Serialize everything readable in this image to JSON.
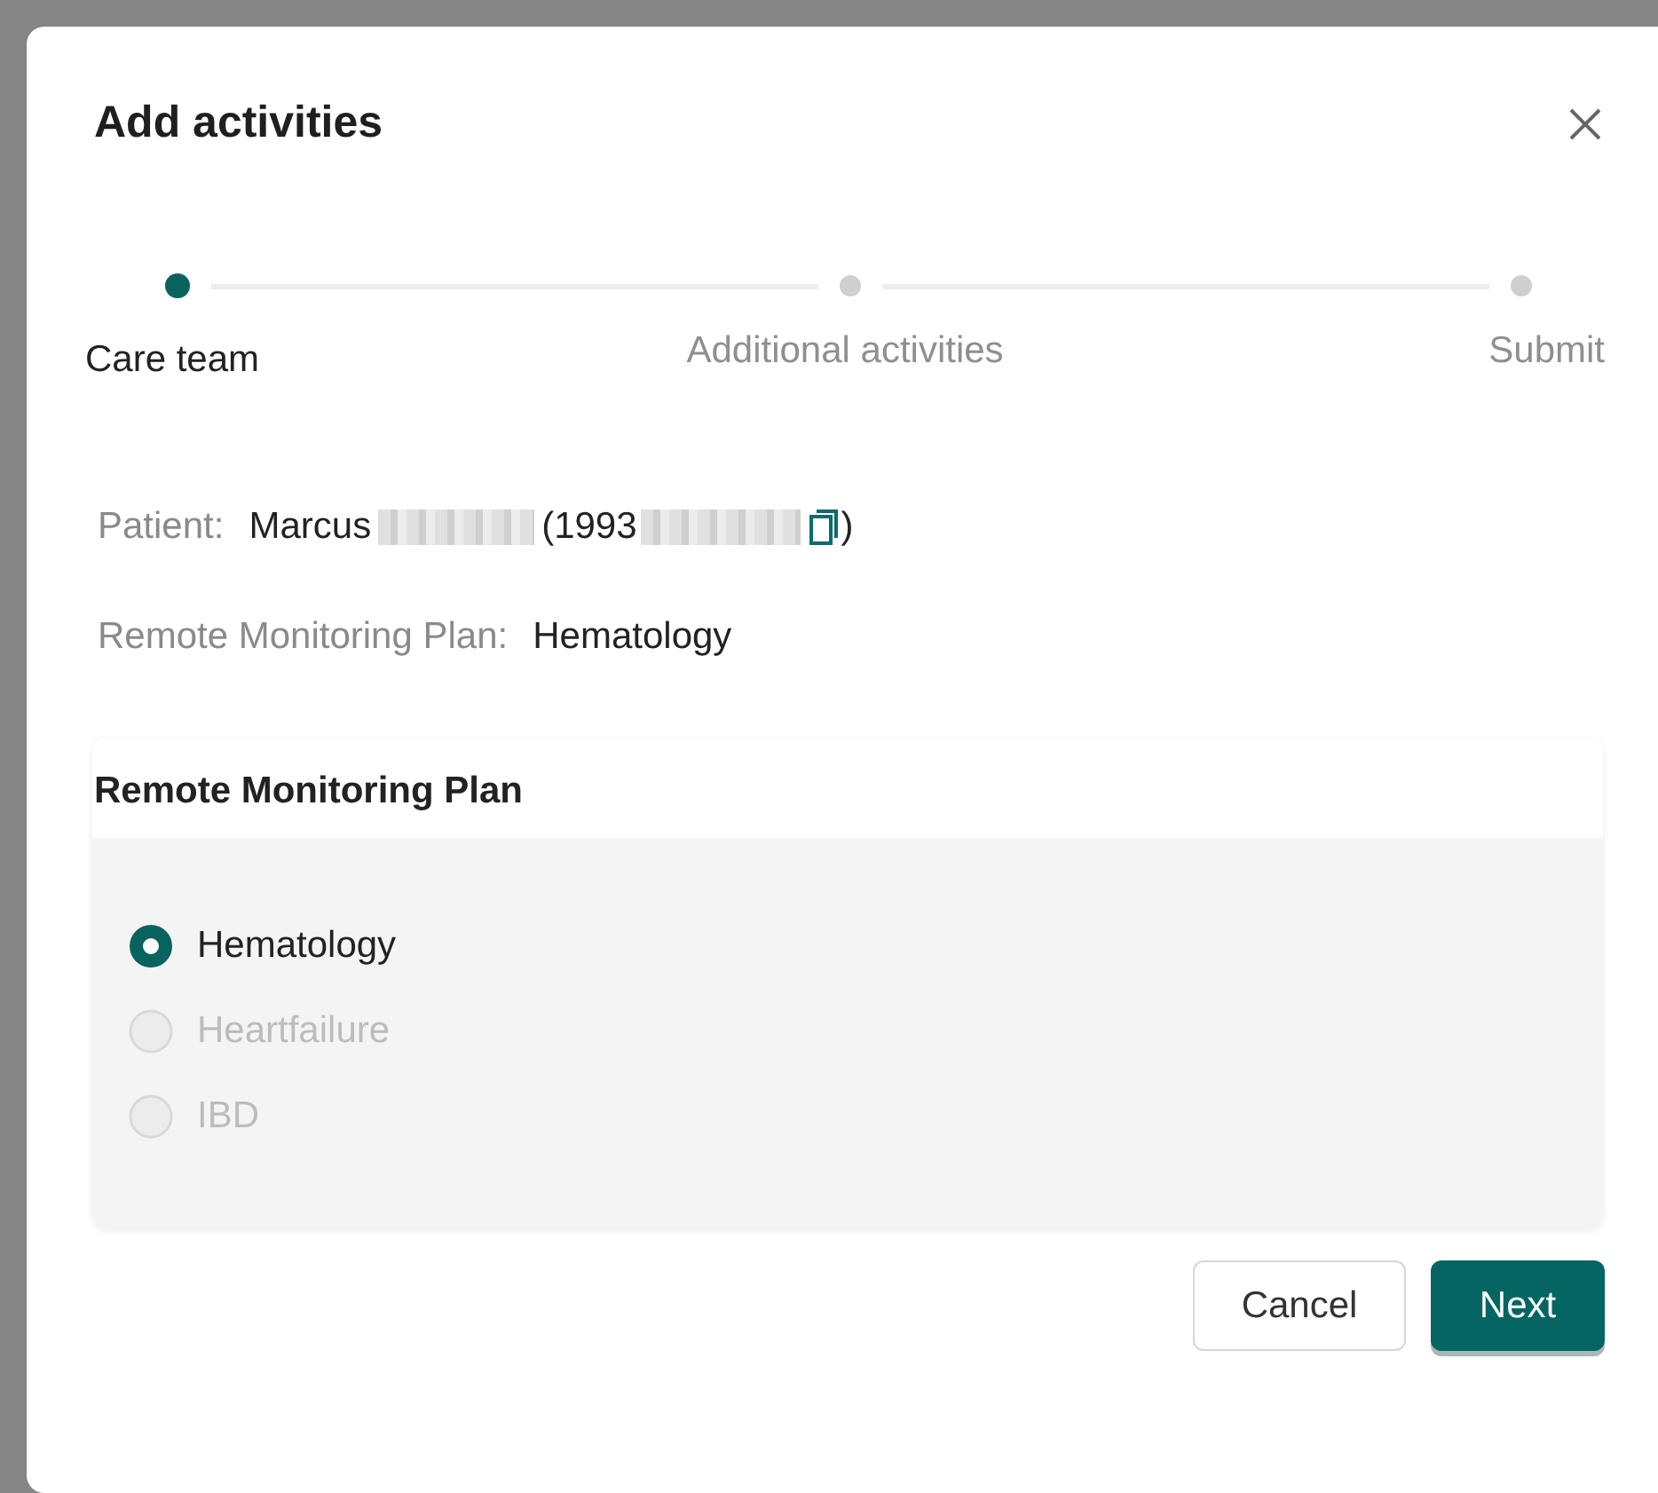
{
  "dialog": {
    "title": "Add activities"
  },
  "steps": [
    {
      "label": "Care team",
      "selected": true
    },
    {
      "label": "Additional activities",
      "selected": false
    },
    {
      "label": "Submit",
      "selected": false
    }
  ],
  "patient": {
    "label": "Patient:",
    "name": "Marcus",
    "id_prefix": "(1993",
    "close_paren": ")"
  },
  "plan_summary": {
    "label": "Remote Monitoring Plan:",
    "value": "Hematology"
  },
  "plan_card": {
    "title": "Remote Monitoring Plan",
    "options": [
      {
        "label": "Hematology",
        "selected": true,
        "disabled": false
      },
      {
        "label": "Heartfailure",
        "selected": false,
        "disabled": true
      },
      {
        "label": "IBD",
        "selected": false,
        "disabled": true
      }
    ]
  },
  "buttons": [
    {
      "label": "Cancel",
      "kind": "secondary"
    },
    {
      "label": "Next",
      "kind": "primary"
    }
  ]
}
